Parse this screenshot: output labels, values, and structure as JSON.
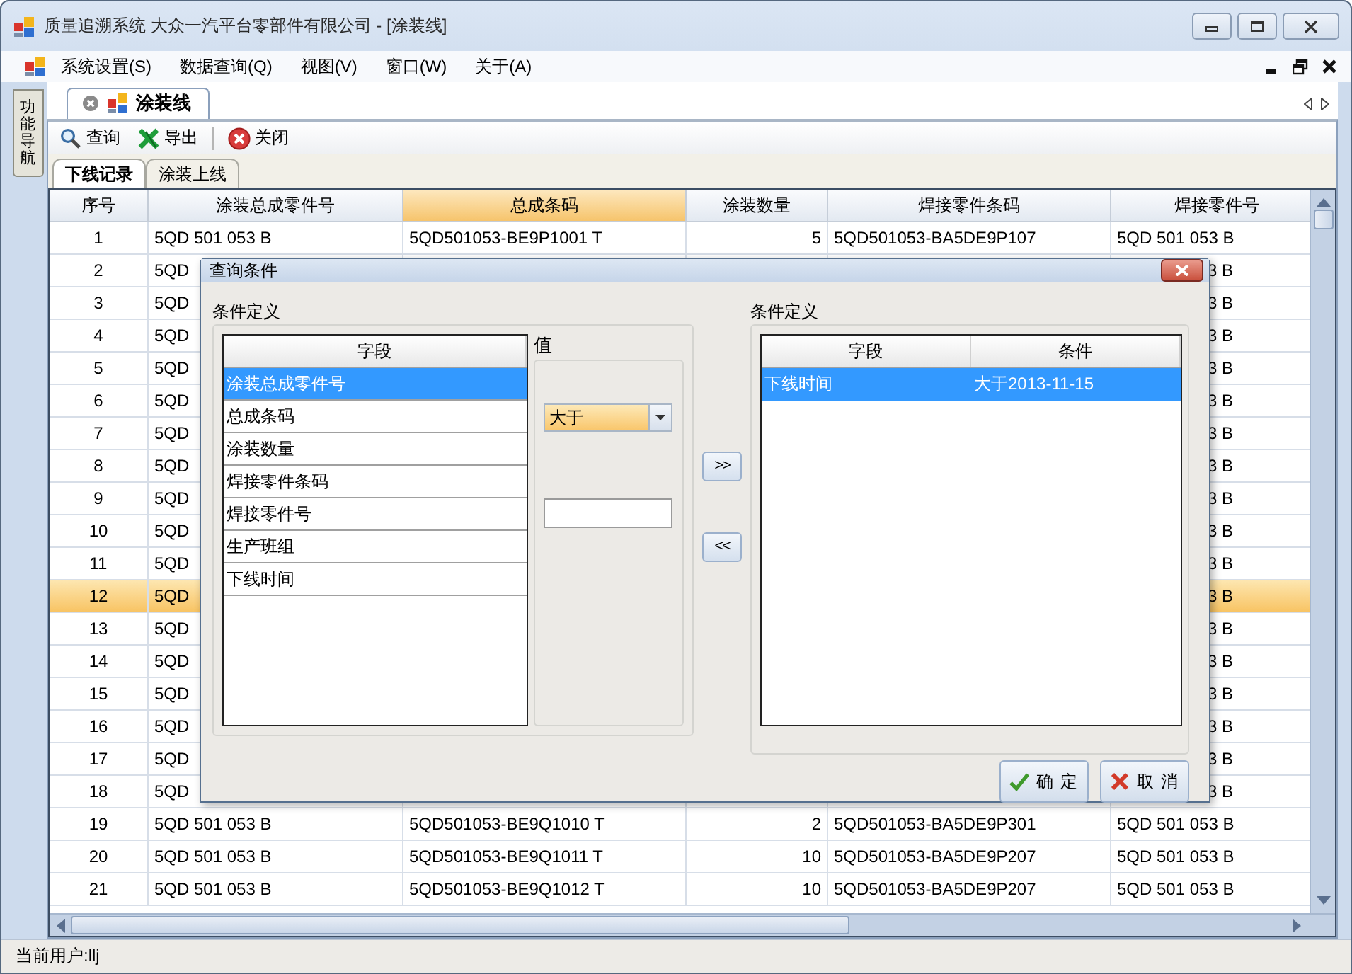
{
  "window": {
    "title": "质量追溯系统  大众一汽平台零部件有限公司 - [涂装线]"
  },
  "menu": [
    {
      "label": "系统设置(S)"
    },
    {
      "label": "数据查询(Q)"
    },
    {
      "label": "视图(V)"
    },
    {
      "label": "窗口(W)"
    },
    {
      "label": "关于(A)"
    }
  ],
  "side_panel": {
    "label": "功能导航"
  },
  "doc_tabs": [
    {
      "label": "涂装线",
      "selected": true
    }
  ],
  "toolbar": [
    {
      "label": "查询",
      "kind": "search"
    },
    {
      "label": "导出",
      "kind": "export"
    },
    {
      "label": "关闭",
      "kind": "close"
    }
  ],
  "sub_tabs": [
    {
      "label": "下线记录",
      "selected": true
    },
    {
      "label": "涂装上线",
      "selected": false
    }
  ],
  "table": {
    "columns": [
      {
        "label": "序号",
        "selected": false
      },
      {
        "label": "涂装总成零件号",
        "selected": false
      },
      {
        "label": "总成条码",
        "selected": true
      },
      {
        "label": "涂装数量",
        "selected": false
      },
      {
        "label": "焊接零件条码",
        "selected": false
      },
      {
        "label": "焊接零件号",
        "selected": false
      }
    ],
    "rows": [
      {
        "no": "1",
        "part_no": "5QD 501 053 B",
        "barcode": "5QD501053-BE9P1001 T",
        "qty": "5",
        "weld_barcode": "5QD501053-BA5DE9P107",
        "weld_part_no": "5QD 501 053 B",
        "selected": false
      },
      {
        "no": "2",
        "part_no": "5QD",
        "weld_part_no": "3 B",
        "selected": false
      },
      {
        "no": "3",
        "part_no": "5QD",
        "weld_part_no": "3 B",
        "selected": false
      },
      {
        "no": "4",
        "part_no": "5QD",
        "weld_part_no": "3 B",
        "selected": false
      },
      {
        "no": "5",
        "part_no": "5QD",
        "weld_part_no": "3 B",
        "selected": false
      },
      {
        "no": "6",
        "part_no": "5QD",
        "weld_part_no": "3 B",
        "selected": false
      },
      {
        "no": "7",
        "part_no": "5QD",
        "weld_part_no": "3 B",
        "selected": false
      },
      {
        "no": "8",
        "part_no": "5QD",
        "weld_part_no": "3 B",
        "selected": false
      },
      {
        "no": "9",
        "part_no": "5QD",
        "weld_part_no": "3 B",
        "selected": false
      },
      {
        "no": "10",
        "part_no": "5QD",
        "weld_part_no": "3 B",
        "selected": false
      },
      {
        "no": "11",
        "part_no": "5QD",
        "weld_part_no": "3 B",
        "selected": false
      },
      {
        "no": "12",
        "part_no": "5QD",
        "weld_part_no": "3 B",
        "selected": true
      },
      {
        "no": "13",
        "part_no": "5QD",
        "weld_part_no": "3 B",
        "selected": false
      },
      {
        "no": "14",
        "part_no": "5QD",
        "weld_part_no": "3 B",
        "selected": false
      },
      {
        "no": "15",
        "part_no": "5QD",
        "weld_part_no": "3 B",
        "selected": false
      },
      {
        "no": "16",
        "part_no": "5QD",
        "weld_part_no": "3 B",
        "selected": false
      },
      {
        "no": "17",
        "part_no": "5QD",
        "weld_part_no": "3 B",
        "selected": false
      },
      {
        "no": "18",
        "part_no": "5QD",
        "weld_part_no": "3 B",
        "selected": false
      },
      {
        "no": "19",
        "part_no": "5QD 501 053 B",
        "barcode": "5QD501053-BE9Q1010 T",
        "qty": "2",
        "weld_barcode": "5QD501053-BA5DE9P301",
        "weld_part_no": "5QD 501 053 B",
        "selected": false
      },
      {
        "no": "20",
        "part_no": "5QD 501 053 B",
        "barcode": "5QD501053-BE9Q1011 T",
        "qty": "10",
        "weld_barcode": "5QD501053-BA5DE9P207",
        "weld_part_no": "5QD 501 053 B",
        "selected": false
      },
      {
        "no": "21",
        "part_no": "5QD 501 053 B",
        "barcode": "5QD501053-BE9Q1012 T",
        "qty": "10",
        "weld_barcode": "5QD501053-BA5DE9P207",
        "weld_part_no": "5QD 501 053 B",
        "selected": false
      }
    ]
  },
  "dialog": {
    "title": "查询条件",
    "left_group": {
      "title": "条件定义",
      "column": "字段",
      "fields": [
        {
          "label": "涂装总成零件号",
          "selected": true
        },
        {
          "label": "总成条码",
          "selected": false
        },
        {
          "label": "涂装数量",
          "selected": false
        },
        {
          "label": "焊接零件条码",
          "selected": false
        },
        {
          "label": "焊接零件号",
          "selected": false
        },
        {
          "label": "生产班组",
          "selected": false
        },
        {
          "label": "下线时间",
          "selected": false
        }
      ]
    },
    "value_group": {
      "title": "值",
      "operator": "大于"
    },
    "move_buttons": [
      {
        "label": ">>"
      },
      {
        "label": "<<"
      }
    ],
    "right_group": {
      "title": "条件定义",
      "columns": [
        "字段",
        "条件"
      ],
      "rows": [
        {
          "field": "下线时间",
          "condition": "大于2013-11-15",
          "selected": true
        }
      ]
    },
    "buttons": [
      {
        "label": "确 定",
        "kind": "ok"
      },
      {
        "label": "取 消",
        "kind": "cancel"
      }
    ]
  },
  "status_bar": {
    "user": "当前用户:llj"
  }
}
